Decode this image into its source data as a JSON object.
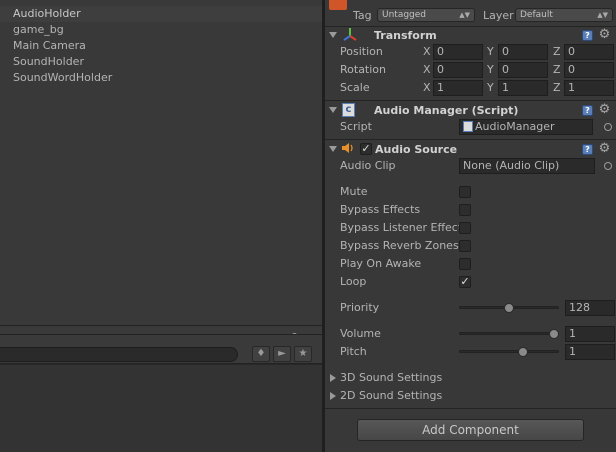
{
  "hierarchy": {
    "items": [
      {
        "label": "AudioHolder",
        "selected": true
      },
      {
        "label": "game_bg",
        "selected": false
      },
      {
        "label": "Main Camera",
        "selected": false
      },
      {
        "label": "SoundHolder",
        "selected": false
      },
      {
        "label": "SoundWordHolder",
        "selected": false
      }
    ]
  },
  "inspector": {
    "tag_label": "Tag",
    "tag_value": "Untagged",
    "layer_label": "Layer",
    "layer_value": "Default",
    "transform": {
      "title": "Transform",
      "rows": [
        {
          "label": "Position",
          "x": "0",
          "y": "0",
          "z": "0"
        },
        {
          "label": "Rotation",
          "x": "0",
          "y": "0",
          "z": "0"
        },
        {
          "label": "Scale",
          "x": "1",
          "y": "1",
          "z": "1"
        }
      ],
      "axis_x": "X",
      "axis_y": "Y",
      "axis_z": "Z"
    },
    "audio_manager": {
      "title": "Audio Manager (Script)",
      "script_label": "Script",
      "script_value": "AudioManager"
    },
    "audio_source": {
      "title": "Audio Source",
      "enabled": true,
      "clip_label": "Audio Clip",
      "clip_value": "None (Audio Clip)",
      "toggles": [
        {
          "label": "Mute",
          "checked": false
        },
        {
          "label": "Bypass Effects",
          "checked": false
        },
        {
          "label": "Bypass Listener Effect",
          "checked": false
        },
        {
          "label": "Bypass Reverb Zones",
          "checked": false
        },
        {
          "label": "Play On Awake",
          "checked": false
        },
        {
          "label": "Loop",
          "checked": true
        }
      ],
      "sliders": [
        {
          "label": "Priority",
          "value": "128",
          "fraction": 0.5
        },
        {
          "label": "Volume",
          "value": "1",
          "fraction": 1.0
        },
        {
          "label": "Pitch",
          "value": "1",
          "fraction": 0.66
        }
      ],
      "foldouts": [
        {
          "label": "3D Sound Settings"
        },
        {
          "label": "2D Sound Settings"
        }
      ]
    },
    "add_component_label": "Add Component"
  },
  "icons": {
    "help": "help-icon",
    "gear": "gear-icon",
    "lock": "lock-icon",
    "menu": "menu-icon",
    "script": "script-icon",
    "speaker": "speaker-icon",
    "transform": "transform-axes-icon"
  },
  "colors": {
    "panel_bg": "#383838",
    "field_bg": "#2a2a2a",
    "help_blue": "#5a7fb8",
    "speaker_orange": "#e8912b"
  }
}
